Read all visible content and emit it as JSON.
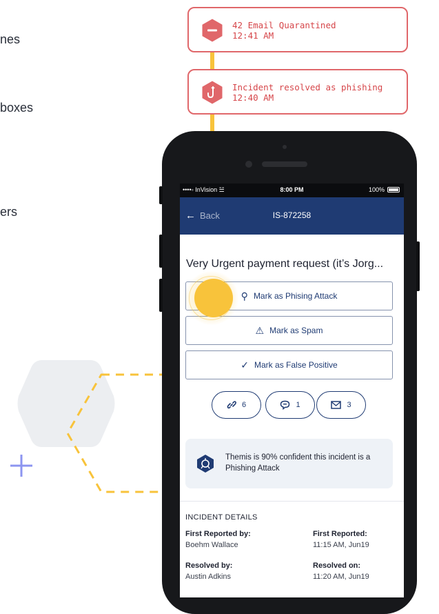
{
  "side_text": [
    "nes",
    "boxes",
    "ers"
  ],
  "notifications": [
    {
      "icon": "minus-hexagon-icon",
      "line1": "42 Email Quarantined",
      "line2": "12:41 AM"
    },
    {
      "icon": "hook-hexagon-icon",
      "line1": "Incident resolved as phishing",
      "line2": "12:40 AM"
    }
  ],
  "statusbar": {
    "carrier": "••••◦ InVision ☱",
    "time": "8:00 PM",
    "battery": "100%"
  },
  "navbar": {
    "back_label": "Back",
    "title": "IS-872258"
  },
  "subject": "Very Urgent payment request (it’s Jorg...",
  "actions": [
    {
      "icon": "hook-icon",
      "glyph": "⚲",
      "label": "Mark as Phising Attack"
    },
    {
      "icon": "warning-icon",
      "glyph": "⚠",
      "label": "Mark as Spam"
    },
    {
      "icon": "check-icon",
      "glyph": "✓",
      "label": "Mark as False Positive"
    }
  ],
  "pills": [
    {
      "icon": "link-icon",
      "glyph": "🔗",
      "count": "6"
    },
    {
      "icon": "comment-icon",
      "glyph": "💬",
      "count": "1"
    },
    {
      "icon": "mail-icon",
      "glyph": "✉",
      "count": "3"
    }
  ],
  "themis": {
    "text": "Themis is 90% confident this incident is a Phishing Attack"
  },
  "details": {
    "title": "INCIDENT DETAILS",
    "first_reported_by_label": "First Reported by:",
    "first_reported_by_value": "Boehm Wallace",
    "first_reported_label": "First Reported:",
    "first_reported_value": "11:15 AM, Jun19",
    "resolved_by_label": "Resolved by:",
    "resolved_by_value": "Austin Adkins",
    "resolved_on_label": "Resolved on:",
    "resolved_on_value": "11:20 AM, Jun19"
  },
  "colors": {
    "navy": "#1f3b73",
    "alert_red": "#e0676a",
    "accent_yellow": "#f8c33b"
  }
}
